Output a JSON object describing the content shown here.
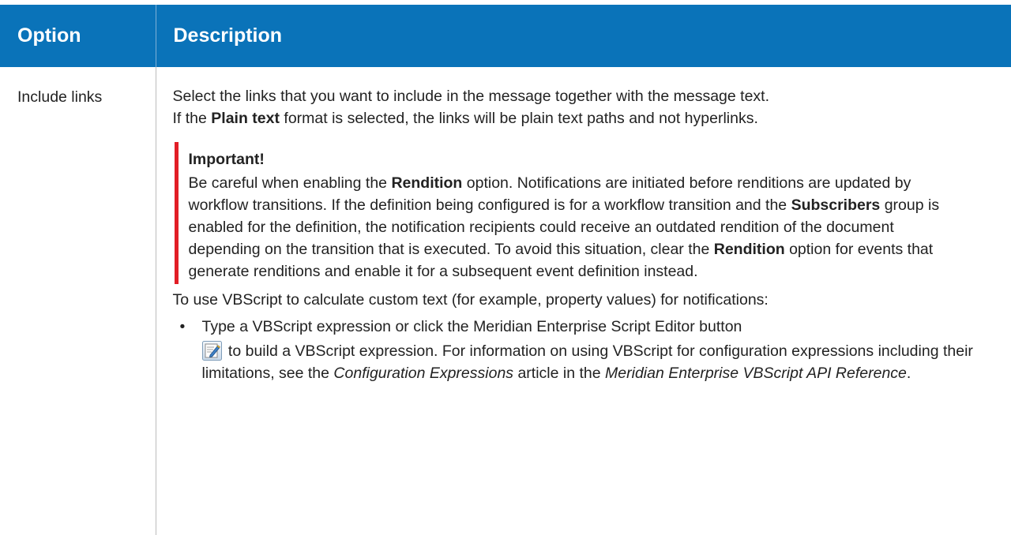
{
  "table": {
    "headers": {
      "option": "Option",
      "description": "Description"
    },
    "row": {
      "option": "Include links",
      "intro_line1": "Select the links that you want to include in the message together with the message text.",
      "intro_line2_pre": "If the ",
      "intro_line2_bold": "Plain text",
      "intro_line2_post": " format is selected, the links will be plain text paths and not hyperlinks.",
      "important": {
        "title": "Important!",
        "t1": "Be careful when enabling the ",
        "b1": "Rendition",
        "t2": " option. Notifications are initiated before renditions are updated by workflow transitions. If the definition being configured is for a workflow transition and the ",
        "b2": "Subscribers",
        "t3": " group is enabled for the definition, the notification recipients could receive an outdated rendition of the document depending on the transition that is executed. To avoid this situation, clear the ",
        "b3": "Rendition",
        "t4": " option for events that generate renditions and enable it for a subsequent event definition instead."
      },
      "script_intro": "To use VBScript to calculate custom text (for example, property values) for notifications:",
      "bullet": {
        "marker": "•",
        "t1": "Type a VBScript expression or click the Meridian Enterprise Script Editor button",
        "icon": "script-editor-icon",
        "t2": " to build a VBScript expression.  For information on using VBScript for configuration expressions including their limitations, see the ",
        "i1": "Configuration Expressions",
        "t3": " article in the ",
        "i2": "Meridian Enterprise VBScript API Reference",
        "t4": "."
      }
    }
  },
  "colors": {
    "header_bg": "#0a73b9",
    "header_text": "#ffffff",
    "important_bar": "#e21e26",
    "text": "#222222"
  }
}
